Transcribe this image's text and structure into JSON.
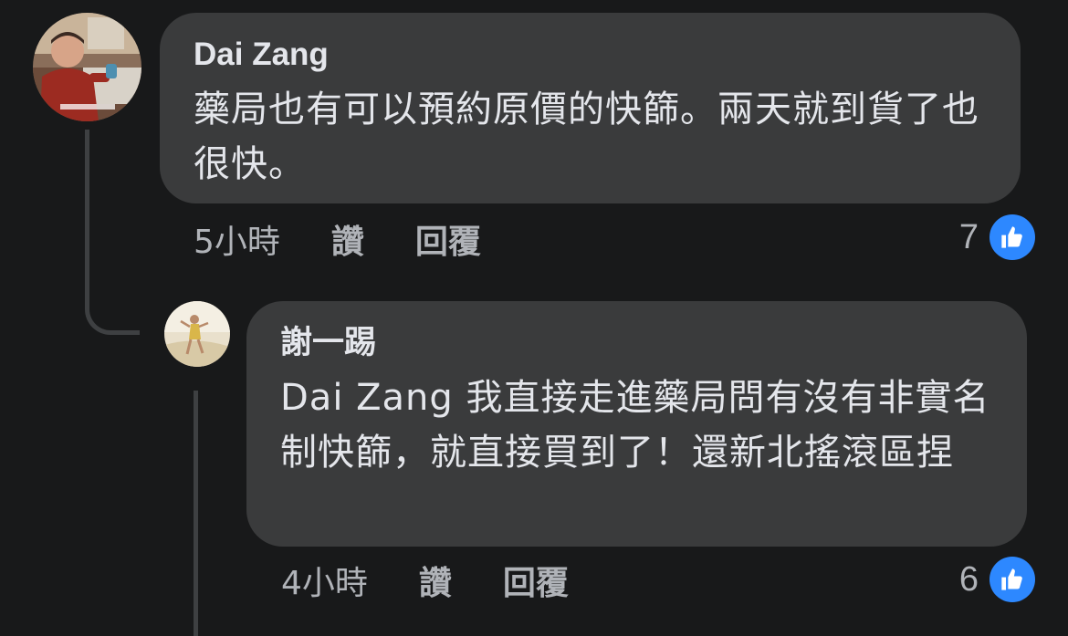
{
  "colors": {
    "background": "#18191a",
    "bubble": "#3a3b3c",
    "text": "#e4e6eb",
    "meta_text": "#b0b3b8",
    "like_blue": "#2d88ff"
  },
  "comments": [
    {
      "author": "Dai Zang",
      "text": "藥局也有可以預約原價的快篩。兩天就到貨了也很快。",
      "time": "5小時",
      "like_label": "讚",
      "reply_label": "回覆",
      "reaction_count": "7",
      "avatar_icon": "avatar-photo"
    },
    {
      "author": "謝一踢",
      "text": "Dai Zang 我直接走進藥局問有沒有非實名制快篩，就直接買到了！還新北搖滾區捏",
      "time": "4小時",
      "like_label": "讚",
      "reply_label": "回覆",
      "reaction_count": "6",
      "avatar_icon": "avatar-photo"
    }
  ]
}
